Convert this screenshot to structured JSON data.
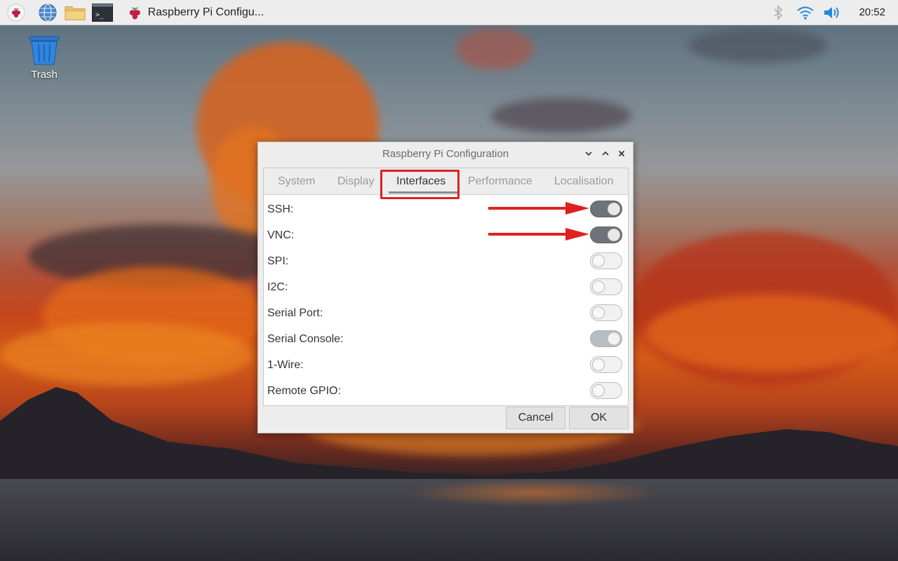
{
  "taskbar": {
    "launchers": [
      {
        "name": "raspberry-menu-icon"
      },
      {
        "name": "web-browser-icon"
      },
      {
        "name": "file-manager-icon"
      },
      {
        "name": "terminal-icon"
      }
    ],
    "task_label": "Raspberry Pi Configu...",
    "clock": "20:52",
    "tray_icons": [
      "bluetooth-icon",
      "wifi-icon",
      "volume-icon"
    ]
  },
  "desktop": {
    "trash_label": "Trash"
  },
  "dialog": {
    "title": "Raspberry Pi Configuration",
    "tabs": [
      "System",
      "Display",
      "Interfaces",
      "Performance",
      "Localisation"
    ],
    "active_tab": "Interfaces",
    "settings": [
      {
        "label": "SSH:",
        "state": "on"
      },
      {
        "label": "VNC:",
        "state": "on"
      },
      {
        "label": "SPI:",
        "state": "off"
      },
      {
        "label": "I2C:",
        "state": "off"
      },
      {
        "label": "Serial Port:",
        "state": "off"
      },
      {
        "label": "Serial Console:",
        "state": "on-disabled"
      },
      {
        "label": "1-Wire:",
        "state": "off"
      },
      {
        "label": "Remote GPIO:",
        "state": "off"
      }
    ],
    "buttons": {
      "cancel": "Cancel",
      "ok": "OK"
    }
  },
  "colors": {
    "annotation_red": "#e02020",
    "switch_on": "#6e7379",
    "panel_bg": "#ededed"
  }
}
